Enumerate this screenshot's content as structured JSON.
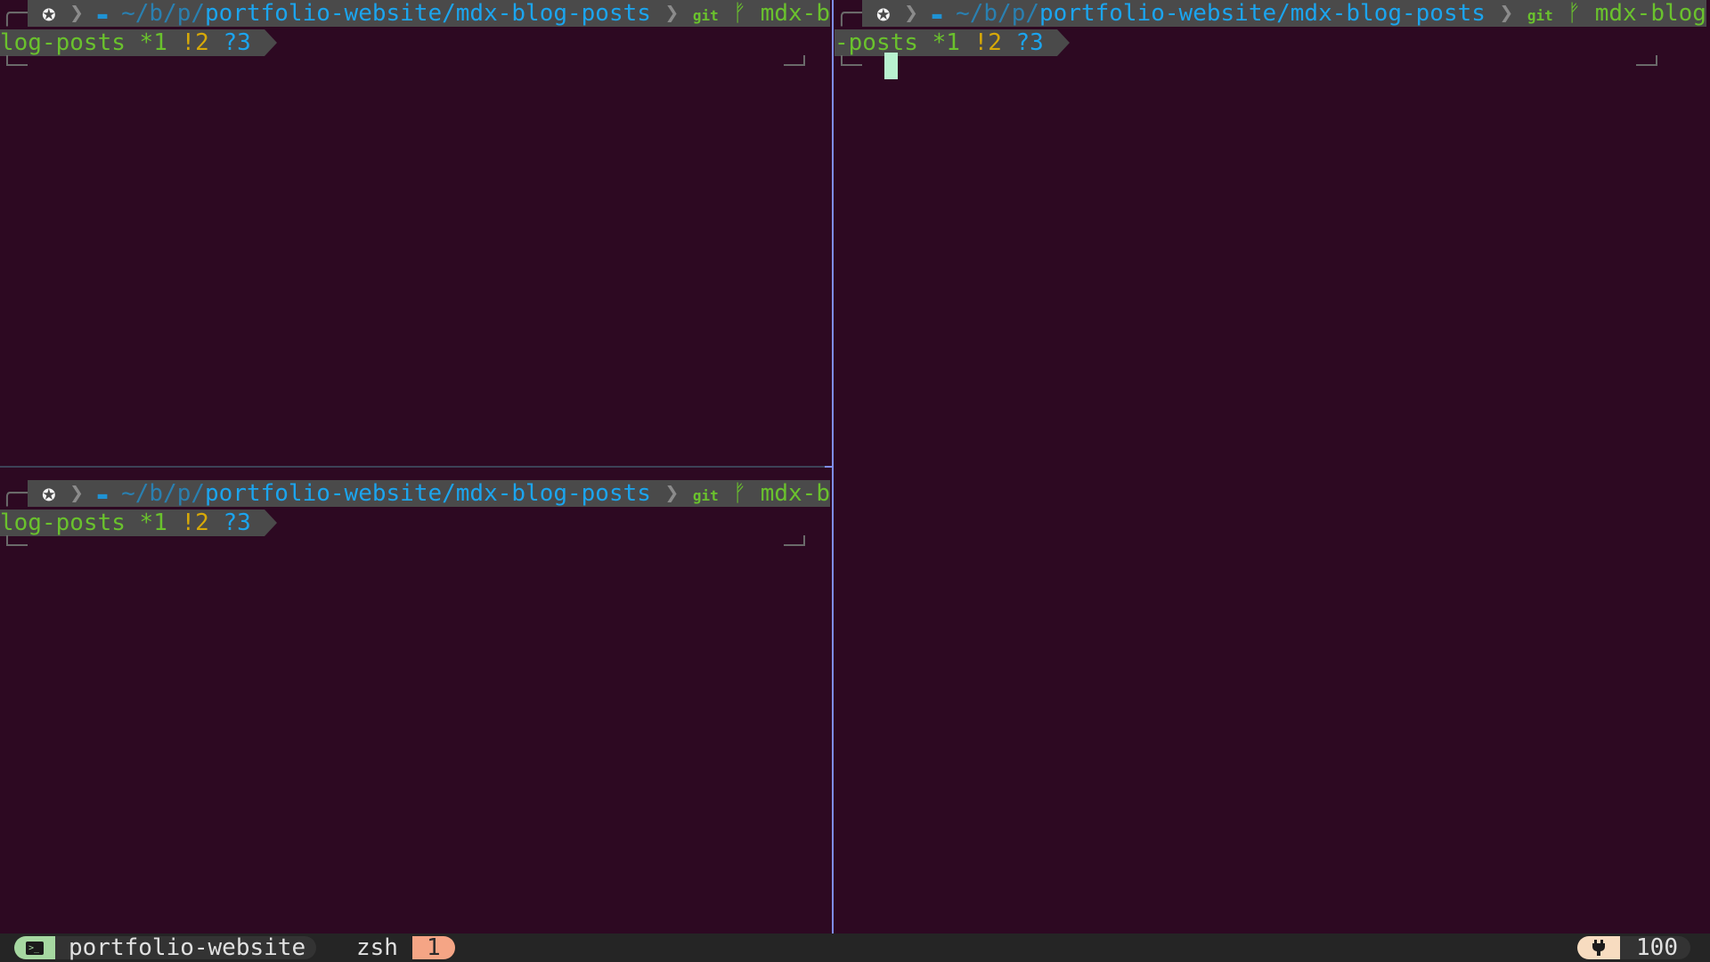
{
  "prompt": {
    "os_icon": "✪",
    "separator": "❯",
    "folder_icon": "▬",
    "dir_prefix": "~/b/p/",
    "dir_main": "portfolio-website/mdx-blog-posts",
    "git_icon": "git",
    "branch_icon": "ᚠ",
    "branch": "mdx-blog-posts",
    "status_star": "*1",
    "status_bang": "!2",
    "status_question": "?3"
  },
  "statusbar": {
    "session_name": "portfolio-website",
    "session_icon": ">_",
    "window_name": "zsh",
    "window_index": "1",
    "battery_level": "100"
  },
  "colors": {
    "background": "#2d0922",
    "prompt_segment": "#4a4a4a",
    "directory": "#1ba5ef",
    "git": "#6ac22d",
    "warning": "#d7a908",
    "cursor": "#b8f2cf",
    "active_pane_border": "#7e8df0"
  }
}
